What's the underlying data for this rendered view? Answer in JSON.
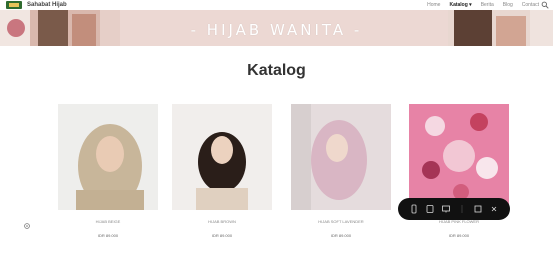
{
  "header": {
    "brand": "Sahabat Hijab",
    "nav": [
      {
        "label": "Home",
        "active": false
      },
      {
        "label": "Katalog ▾",
        "active": true
      },
      {
        "label": "Berita",
        "active": false
      },
      {
        "label": "Blog",
        "active": false
      },
      {
        "label": "Contact",
        "active": false
      }
    ]
  },
  "banner": {
    "title": "- HIJAB WANITA -"
  },
  "page_title": "Katalog",
  "products": [
    {
      "name": "HIJAB BEIGE",
      "price": "IDR 89.000"
    },
    {
      "name": "HIJAB BROWN",
      "price": "IDR 89.000"
    },
    {
      "name": "HIJAB SOFT LAVENDER",
      "price": "IDR 89.000"
    },
    {
      "name": "HIJAB PINK FLOWER",
      "price": "IDR 89.000"
    }
  ],
  "colors": {
    "banner_bg": "#ecd8d3",
    "toolbar_bg": "#111111"
  },
  "icons": [
    "logo-icon",
    "search-icon",
    "settings-icon",
    "toolbar-icons"
  ]
}
